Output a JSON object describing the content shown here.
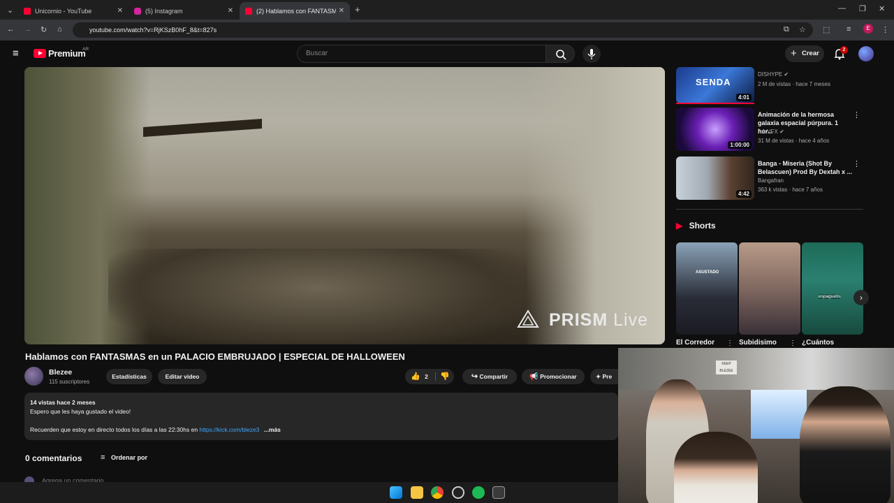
{
  "browser": {
    "tabs": [
      {
        "title": "Unicornio - YouTube",
        "favicon": "youtube-icon",
        "color": "#ff0033"
      },
      {
        "title": "(5) Instagram",
        "favicon": "instagram-icon",
        "color": "#d6249f"
      },
      {
        "title": "(2) Hablamos con FANTASMAS",
        "favicon": "youtube-icon",
        "color": "#ff0033"
      }
    ],
    "url": "youtube.com/watch?v=RjKSzB0hF_8&t=827s"
  },
  "youtube": {
    "logo_text": "Premium",
    "region": "AR",
    "search_placeholder": "Buscar",
    "create_label": "Crear",
    "notif_count": "2"
  },
  "video": {
    "watermark_prism": "PRISM",
    "watermark_live": "Live",
    "title": "Hablamos con FANTASMAS en un PALACIO EMBRUJADO | ESPECIAL DE HALLOWEEN",
    "channel": "Blezee",
    "subscribers": "115 suscriptores",
    "btn_stats": "Estadísticas",
    "btn_edit": "Editar video",
    "likes": "2",
    "btn_share": "Compartir",
    "btn_promote": "Promocionar",
    "btn_more": "Pre"
  },
  "description": {
    "views_date": "14 vistas  hace 2 meses",
    "line1": "Espero que les haya gustado el video!",
    "line2": "Recuerden que estoy en directo todos los días a las 22:30hs en ",
    "link": "https://kick.com/bleze3",
    "more": "...más"
  },
  "comments": {
    "count_label": "0 comentarios",
    "sort_label": "Ordenar por",
    "add_placeholder": "Agrega un comentario..."
  },
  "sidebar": {
    "items": [
      {
        "thumb_text": "SENDA",
        "duration": "4:01",
        "title": "",
        "channel": "DISHYPE",
        "meta": "2 M de vistas · hace 7 meses"
      },
      {
        "duration": "1:00:00",
        "title": "Animación de la hermosa galaxia espacial púrpura. 1 hor...",
        "channel": "AA-VFX",
        "meta": "31 M de vistas · hace 4 años"
      },
      {
        "duration": "4:42",
        "title": "Banga - Miseria (Shot By Belascuen) Prod By Dextah x ...",
        "channel": "Bangafran",
        "meta": "363 k vistas · hace 7 años"
      }
    ],
    "shorts_heading": "Shorts",
    "shorts": [
      {
        "title": "El Corredor",
        "overlay": "ASUSTADO"
      },
      {
        "title": "Subidisimo",
        "overlay": ""
      },
      {
        "title": "¿Cuántos",
        "overlay": "espaguetis"
      }
    ]
  },
  "webcam": {
    "sign_text": "KEEP BLEZEE"
  }
}
